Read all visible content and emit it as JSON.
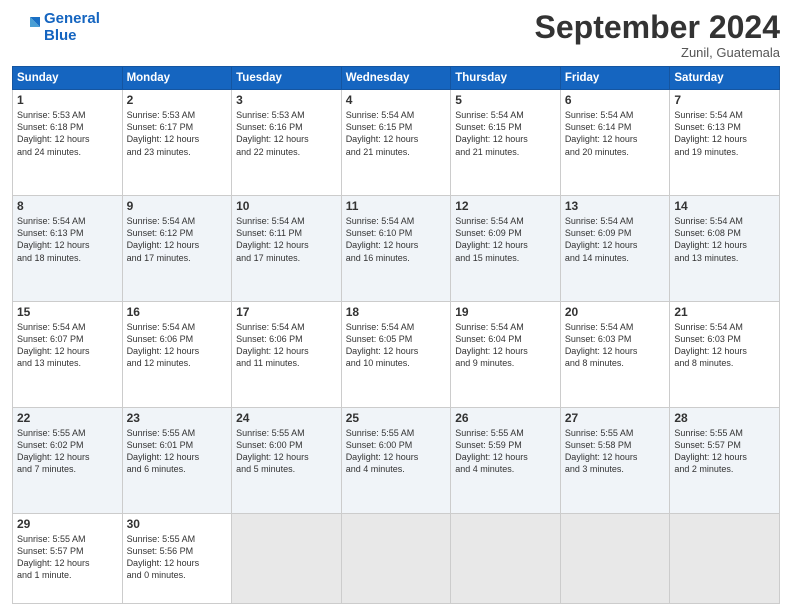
{
  "header": {
    "logo_line1": "General",
    "logo_line2": "Blue",
    "month": "September 2024",
    "location": "Zunil, Guatemala"
  },
  "days_of_week": [
    "Sunday",
    "Monday",
    "Tuesday",
    "Wednesday",
    "Thursday",
    "Friday",
    "Saturday"
  ],
  "weeks": [
    [
      {
        "day": "1",
        "lines": [
          "Sunrise: 5:53 AM",
          "Sunset: 6:18 PM",
          "Daylight: 12 hours",
          "and 24 minutes."
        ]
      },
      {
        "day": "2",
        "lines": [
          "Sunrise: 5:53 AM",
          "Sunset: 6:17 PM",
          "Daylight: 12 hours",
          "and 23 minutes."
        ]
      },
      {
        "day": "3",
        "lines": [
          "Sunrise: 5:53 AM",
          "Sunset: 6:16 PM",
          "Daylight: 12 hours",
          "and 22 minutes."
        ]
      },
      {
        "day": "4",
        "lines": [
          "Sunrise: 5:54 AM",
          "Sunset: 6:15 PM",
          "Daylight: 12 hours",
          "and 21 minutes."
        ]
      },
      {
        "day": "5",
        "lines": [
          "Sunrise: 5:54 AM",
          "Sunset: 6:15 PM",
          "Daylight: 12 hours",
          "and 21 minutes."
        ]
      },
      {
        "day": "6",
        "lines": [
          "Sunrise: 5:54 AM",
          "Sunset: 6:14 PM",
          "Daylight: 12 hours",
          "and 20 minutes."
        ]
      },
      {
        "day": "7",
        "lines": [
          "Sunrise: 5:54 AM",
          "Sunset: 6:13 PM",
          "Daylight: 12 hours",
          "and 19 minutes."
        ]
      }
    ],
    [
      {
        "day": "8",
        "lines": [
          "Sunrise: 5:54 AM",
          "Sunset: 6:13 PM",
          "Daylight: 12 hours",
          "and 18 minutes."
        ]
      },
      {
        "day": "9",
        "lines": [
          "Sunrise: 5:54 AM",
          "Sunset: 6:12 PM",
          "Daylight: 12 hours",
          "and 17 minutes."
        ]
      },
      {
        "day": "10",
        "lines": [
          "Sunrise: 5:54 AM",
          "Sunset: 6:11 PM",
          "Daylight: 12 hours",
          "and 17 minutes."
        ]
      },
      {
        "day": "11",
        "lines": [
          "Sunrise: 5:54 AM",
          "Sunset: 6:10 PM",
          "Daylight: 12 hours",
          "and 16 minutes."
        ]
      },
      {
        "day": "12",
        "lines": [
          "Sunrise: 5:54 AM",
          "Sunset: 6:09 PM",
          "Daylight: 12 hours",
          "and 15 minutes."
        ]
      },
      {
        "day": "13",
        "lines": [
          "Sunrise: 5:54 AM",
          "Sunset: 6:09 PM",
          "Daylight: 12 hours",
          "and 14 minutes."
        ]
      },
      {
        "day": "14",
        "lines": [
          "Sunrise: 5:54 AM",
          "Sunset: 6:08 PM",
          "Daylight: 12 hours",
          "and 13 minutes."
        ]
      }
    ],
    [
      {
        "day": "15",
        "lines": [
          "Sunrise: 5:54 AM",
          "Sunset: 6:07 PM",
          "Daylight: 12 hours",
          "and 13 minutes."
        ]
      },
      {
        "day": "16",
        "lines": [
          "Sunrise: 5:54 AM",
          "Sunset: 6:06 PM",
          "Daylight: 12 hours",
          "and 12 minutes."
        ]
      },
      {
        "day": "17",
        "lines": [
          "Sunrise: 5:54 AM",
          "Sunset: 6:06 PM",
          "Daylight: 12 hours",
          "and 11 minutes."
        ]
      },
      {
        "day": "18",
        "lines": [
          "Sunrise: 5:54 AM",
          "Sunset: 6:05 PM",
          "Daylight: 12 hours",
          "and 10 minutes."
        ]
      },
      {
        "day": "19",
        "lines": [
          "Sunrise: 5:54 AM",
          "Sunset: 6:04 PM",
          "Daylight: 12 hours",
          "and 9 minutes."
        ]
      },
      {
        "day": "20",
        "lines": [
          "Sunrise: 5:54 AM",
          "Sunset: 6:03 PM",
          "Daylight: 12 hours",
          "and 8 minutes."
        ]
      },
      {
        "day": "21",
        "lines": [
          "Sunrise: 5:54 AM",
          "Sunset: 6:03 PM",
          "Daylight: 12 hours",
          "and 8 minutes."
        ]
      }
    ],
    [
      {
        "day": "22",
        "lines": [
          "Sunrise: 5:55 AM",
          "Sunset: 6:02 PM",
          "Daylight: 12 hours",
          "and 7 minutes."
        ]
      },
      {
        "day": "23",
        "lines": [
          "Sunrise: 5:55 AM",
          "Sunset: 6:01 PM",
          "Daylight: 12 hours",
          "and 6 minutes."
        ]
      },
      {
        "day": "24",
        "lines": [
          "Sunrise: 5:55 AM",
          "Sunset: 6:00 PM",
          "Daylight: 12 hours",
          "and 5 minutes."
        ]
      },
      {
        "day": "25",
        "lines": [
          "Sunrise: 5:55 AM",
          "Sunset: 6:00 PM",
          "Daylight: 12 hours",
          "and 4 minutes."
        ]
      },
      {
        "day": "26",
        "lines": [
          "Sunrise: 5:55 AM",
          "Sunset: 5:59 PM",
          "Daylight: 12 hours",
          "and 4 minutes."
        ]
      },
      {
        "day": "27",
        "lines": [
          "Sunrise: 5:55 AM",
          "Sunset: 5:58 PM",
          "Daylight: 12 hours",
          "and 3 minutes."
        ]
      },
      {
        "day": "28",
        "lines": [
          "Sunrise: 5:55 AM",
          "Sunset: 5:57 PM",
          "Daylight: 12 hours",
          "and 2 minutes."
        ]
      }
    ],
    [
      {
        "day": "29",
        "lines": [
          "Sunrise: 5:55 AM",
          "Sunset: 5:57 PM",
          "Daylight: 12 hours",
          "and 1 minute."
        ]
      },
      {
        "day": "30",
        "lines": [
          "Sunrise: 5:55 AM",
          "Sunset: 5:56 PM",
          "Daylight: 12 hours",
          "and 0 minutes."
        ]
      },
      {
        "day": "",
        "lines": []
      },
      {
        "day": "",
        "lines": []
      },
      {
        "day": "",
        "lines": []
      },
      {
        "day": "",
        "lines": []
      },
      {
        "day": "",
        "lines": []
      }
    ]
  ]
}
